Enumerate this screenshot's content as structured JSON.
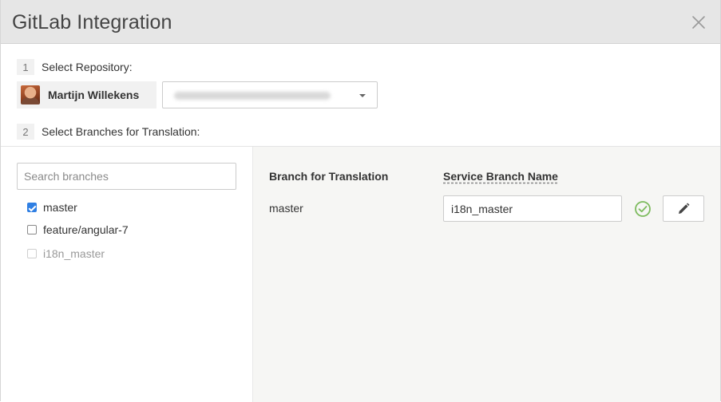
{
  "dialog": {
    "title": "GitLab Integration"
  },
  "steps": [
    {
      "number": "1",
      "label": "Select Repository:"
    },
    {
      "number": "2",
      "label": "Select Branches for Translation:"
    }
  ],
  "repository": {
    "user_name": "Martijn Willekens"
  },
  "branch_search": {
    "placeholder": "Search branches"
  },
  "branches": [
    {
      "name": "master",
      "checked": true,
      "disabled": false
    },
    {
      "name": "feature/angular-7",
      "checked": false,
      "disabled": false
    },
    {
      "name": "i18n_master",
      "checked": false,
      "disabled": true
    }
  ],
  "mapping": {
    "col_branch": "Branch for Translation",
    "col_service": "Service Branch Name",
    "rows": [
      {
        "branch": "master",
        "service_branch": "i18n_master",
        "status": "valid"
      }
    ]
  },
  "colors": {
    "header_bg": "#e6e6e6",
    "checkbox_checked": "#2f7fe3",
    "success": "#7dbb5e",
    "right_pane_bg": "#f6f6f4"
  },
  "icons": {
    "close": "close-icon",
    "dropdown": "chevron-down-icon",
    "status": "check-circle-icon",
    "edit": "pencil-icon"
  }
}
